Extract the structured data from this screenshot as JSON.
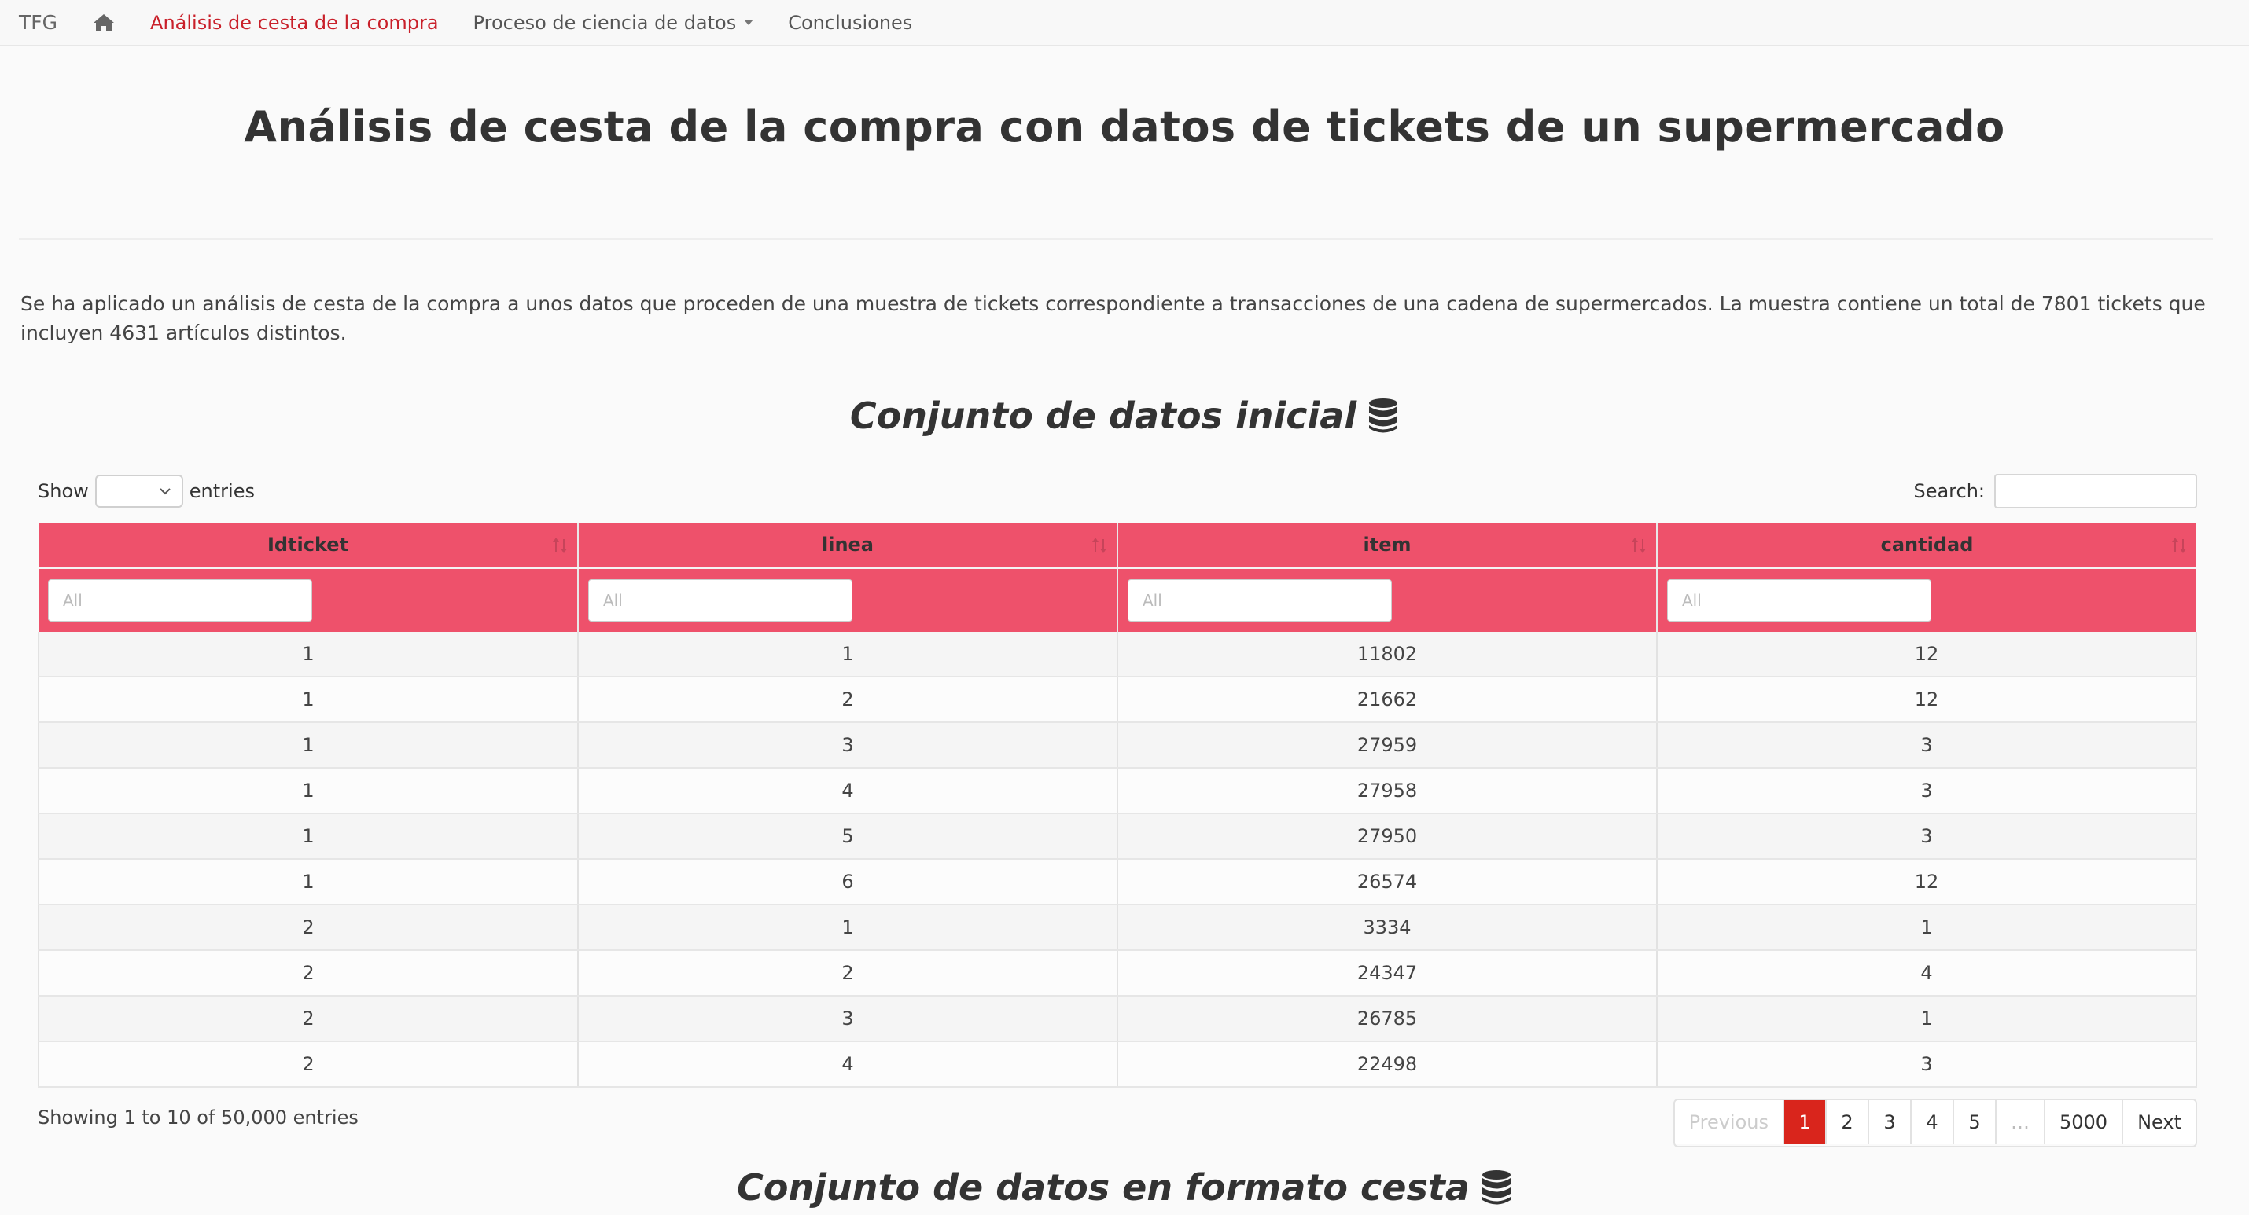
{
  "nav": {
    "brand": "TFG",
    "items": [
      {
        "label": "Análisis de cesta de la compra"
      },
      {
        "label": "Proceso de ciencia de datos"
      },
      {
        "label": "Conclusiones"
      }
    ]
  },
  "page": {
    "title": "Análisis de cesta de la compra con datos de tickets de un supermercado",
    "intro": "Se ha aplicado un análisis de cesta de la compra a unos datos que proceden de una muestra de tickets correspondiente a transacciones de una cadena de supermercados. La muestra contiene un total de 7801 tickets que incluyen 4631 artículos distintos.",
    "section1": "Conjunto de datos inicial",
    "section2": "Conjunto de datos en formato cesta"
  },
  "table": {
    "show_label": "Show",
    "entries_label": "entries",
    "search_label": "Search:",
    "filter_placeholder": "All",
    "columns": [
      "Idticket",
      "linea",
      "item",
      "cantidad"
    ],
    "rows": [
      [
        "1",
        "1",
        "11802",
        "12"
      ],
      [
        "1",
        "2",
        "21662",
        "12"
      ],
      [
        "1",
        "3",
        "27959",
        "3"
      ],
      [
        "1",
        "4",
        "27958",
        "3"
      ],
      [
        "1",
        "5",
        "27950",
        "3"
      ],
      [
        "1",
        "6",
        "26574",
        "12"
      ],
      [
        "2",
        "1",
        "3334",
        "1"
      ],
      [
        "2",
        "2",
        "24347",
        "4"
      ],
      [
        "2",
        "3",
        "26785",
        "1"
      ],
      [
        "2",
        "4",
        "22498",
        "3"
      ]
    ],
    "info": "Showing 1 to 10 of 50,000 entries",
    "pagination": {
      "previous": "Previous",
      "pages": [
        "1",
        "2",
        "3",
        "4",
        "5"
      ],
      "ellipsis": "…",
      "last": "5000",
      "next": "Next",
      "current": "1"
    }
  },
  "colors": {
    "accent": "#c9202a",
    "header_bg": "#ee516b",
    "active_page": "#d9251c"
  },
  "icons": {
    "home": "home-icon",
    "database": "database-icon",
    "sort": "sort-icon",
    "dropdown": "chevron-down-icon"
  }
}
